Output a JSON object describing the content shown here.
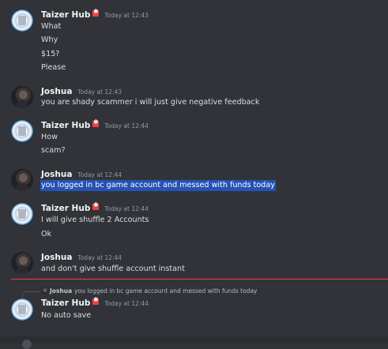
{
  "messages": [
    {
      "author": "Taizer Hub",
      "timestamp": "Today at 12:43",
      "lines": [
        "What",
        "Why",
        "$15?",
        "Please"
      ]
    },
    {
      "author": "Joshua",
      "timestamp": "Today at 12:43",
      "lines": [
        "you are shady scammer i will just give negative feedback"
      ]
    },
    {
      "author": "Taizer Hub",
      "timestamp": "Today at 12:44",
      "lines": [
        "How",
        "scam?"
      ]
    },
    {
      "author": "Joshua",
      "timestamp": "Today at 12:44",
      "lines": [
        "you logged in bc game account and messed with funds today"
      ]
    },
    {
      "author": "Taizer Hub",
      "timestamp": "Today at 12:44",
      "lines": [
        "I will give shuffle 2 Accounts",
        "Ok"
      ]
    },
    {
      "author": "Joshua",
      "timestamp": "Today at 12:44",
      "lines": [
        "and don't give shuffle account instant"
      ]
    },
    {
      "author": "Taizer Hub",
      "timestamp": "Today at 12:44",
      "lines": [
        "No auto save"
      ]
    }
  ],
  "reply": {
    "author": "Joshua",
    "text": "you logged in bc game account and messed with funds today"
  },
  "colors": {
    "background": "#313338",
    "highlight": "#2452b5",
    "new_messages_divider": "#f23f42",
    "badge": "#f23f42"
  }
}
